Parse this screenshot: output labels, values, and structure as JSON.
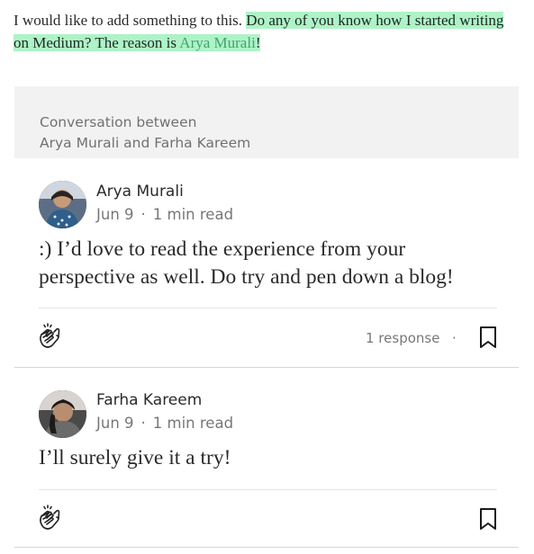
{
  "intro": {
    "plain": "I would like to add something to this. ",
    "highlight_text": "Do any of you know how I started writing on Medium? The reason is ",
    "highlight_link": "Arya Murali",
    "highlight_end": "!",
    "highlight_color": "#aef3c7",
    "link_color": "#3fa56b"
  },
  "conversation": {
    "line1": "Conversation between",
    "line2": "Arya Murali and Farha Kareem"
  },
  "responses": [
    {
      "author": "Arya Murali",
      "date": "Jun 9",
      "separator": "·",
      "read_time": "1 min read",
      "body": ":) I’d love to read the experience from your perspective as well. Do try and pen down a blog!",
      "responses_label": "1 response",
      "footer_dot": "·"
    },
    {
      "author": "Farha Kareem",
      "date": "Jun 9",
      "separator": "·",
      "read_time": "1 min read",
      "body": "I’ll surely give it a try!"
    }
  ],
  "icons": {
    "clap": "clap-icon",
    "bookmark": "bookmark-icon"
  }
}
